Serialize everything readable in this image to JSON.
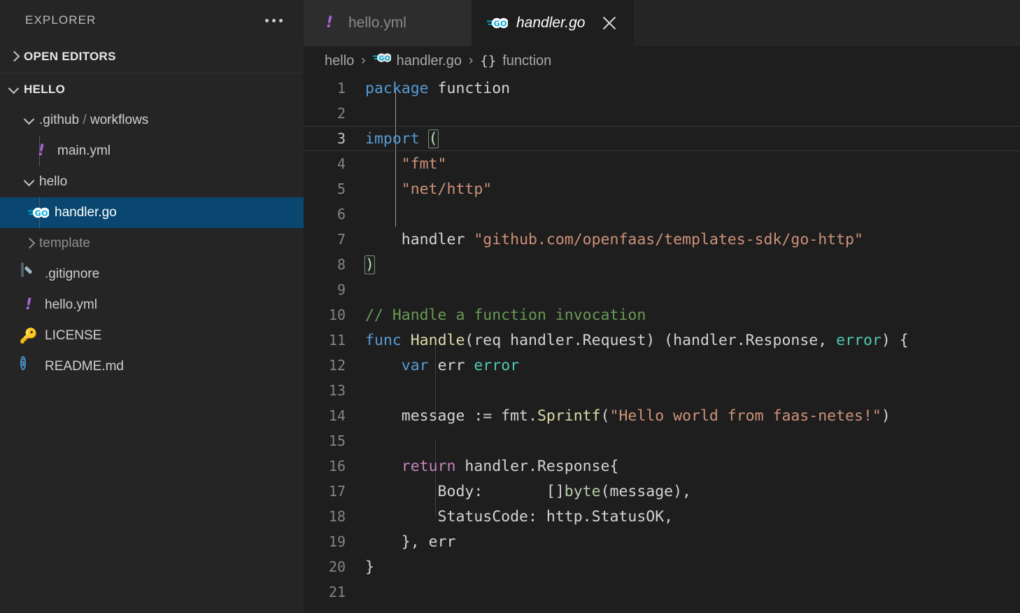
{
  "sidebar": {
    "title": "EXPLORER",
    "more_icon": "ellipsis-icon",
    "sections": [
      {
        "label": "OPEN EDITORS",
        "expanded": false
      },
      {
        "label": "HELLO",
        "expanded": true
      }
    ],
    "tree": [
      {
        "label": ".github / workflows",
        "icon": "folder",
        "depth": 1,
        "expanded": true,
        "selected": false
      },
      {
        "label": "main.yml",
        "icon": "yaml-icon",
        "depth": 2,
        "selected": false
      },
      {
        "label": "hello",
        "icon": "folder",
        "depth": 1,
        "expanded": true,
        "selected": false
      },
      {
        "label": "handler.go",
        "icon": "go-icon",
        "depth": 2,
        "selected": true
      },
      {
        "label": "template",
        "icon": "folder",
        "depth": 1,
        "expanded": false,
        "selected": false,
        "muted": true
      },
      {
        "label": ".gitignore",
        "icon": "git-icon",
        "depth": 1,
        "selected": false
      },
      {
        "label": "hello.yml",
        "icon": "yaml-icon",
        "depth": 1,
        "selected": false
      },
      {
        "label": "LICENSE",
        "icon": "key-icon",
        "depth": 1,
        "selected": false
      },
      {
        "label": "README.md",
        "icon": "info-icon",
        "depth": 1,
        "selected": false
      }
    ]
  },
  "tabs": [
    {
      "label": "hello.yml",
      "icon": "yaml-icon",
      "active": false,
      "closable": false
    },
    {
      "label": "handler.go",
      "icon": "go-icon",
      "active": true,
      "closable": true
    }
  ],
  "breadcrumb": {
    "items": [
      {
        "label": "hello",
        "icon": ""
      },
      {
        "label": "handler.go",
        "icon": "go-icon"
      },
      {
        "label": "function",
        "icon": "braces-icon"
      }
    ],
    "separator": "›"
  },
  "editor": {
    "language": "go",
    "current_line": 3,
    "lines": [
      {
        "n": "1",
        "text": "package function"
      },
      {
        "n": "2",
        "text": ""
      },
      {
        "n": "3",
        "text": "import ("
      },
      {
        "n": "4",
        "text": "    \"fmt\""
      },
      {
        "n": "5",
        "text": "    \"net/http\""
      },
      {
        "n": "6",
        "text": ""
      },
      {
        "n": "7",
        "text": "    handler \"github.com/openfaas/templates-sdk/go-http\""
      },
      {
        "n": "8",
        "text": ")"
      },
      {
        "n": "9",
        "text": ""
      },
      {
        "n": "10",
        "text": "// Handle a function invocation"
      },
      {
        "n": "11",
        "text": "func Handle(req handler.Request) (handler.Response, error) {"
      },
      {
        "n": "12",
        "text": "    var err error"
      },
      {
        "n": "13",
        "text": ""
      },
      {
        "n": "14",
        "text": "    message := fmt.Sprintf(\"Hello world from faas-netes!\")"
      },
      {
        "n": "15",
        "text": ""
      },
      {
        "n": "16",
        "text": "    return handler.Response{"
      },
      {
        "n": "17",
        "text": "        Body:       []byte(message),"
      },
      {
        "n": "18",
        "text": "        StatusCode: http.StatusOK,"
      },
      {
        "n": "19",
        "text": "    }, err"
      },
      {
        "n": "20",
        "text": "}"
      },
      {
        "n": "21",
        "text": ""
      }
    ]
  },
  "colors": {
    "sidebar_bg": "#252526",
    "editor_bg": "#1e1e1e",
    "tab_inactive_bg": "#2d2d2d",
    "selection_blue": "#094771",
    "keyword": "#569cd6",
    "string": "#ce9178",
    "comment": "#6a9955",
    "function": "#dcdcaa",
    "type": "#4ec9b0",
    "control": "#c586c0",
    "number": "#b5cea8",
    "text": "#d4d4d4",
    "line_number": "#858585",
    "go_icon": "#00acd7",
    "yaml_icon": "#a663d4",
    "license_icon": "#e9e94a",
    "readme_icon": "#4a9bd4"
  }
}
